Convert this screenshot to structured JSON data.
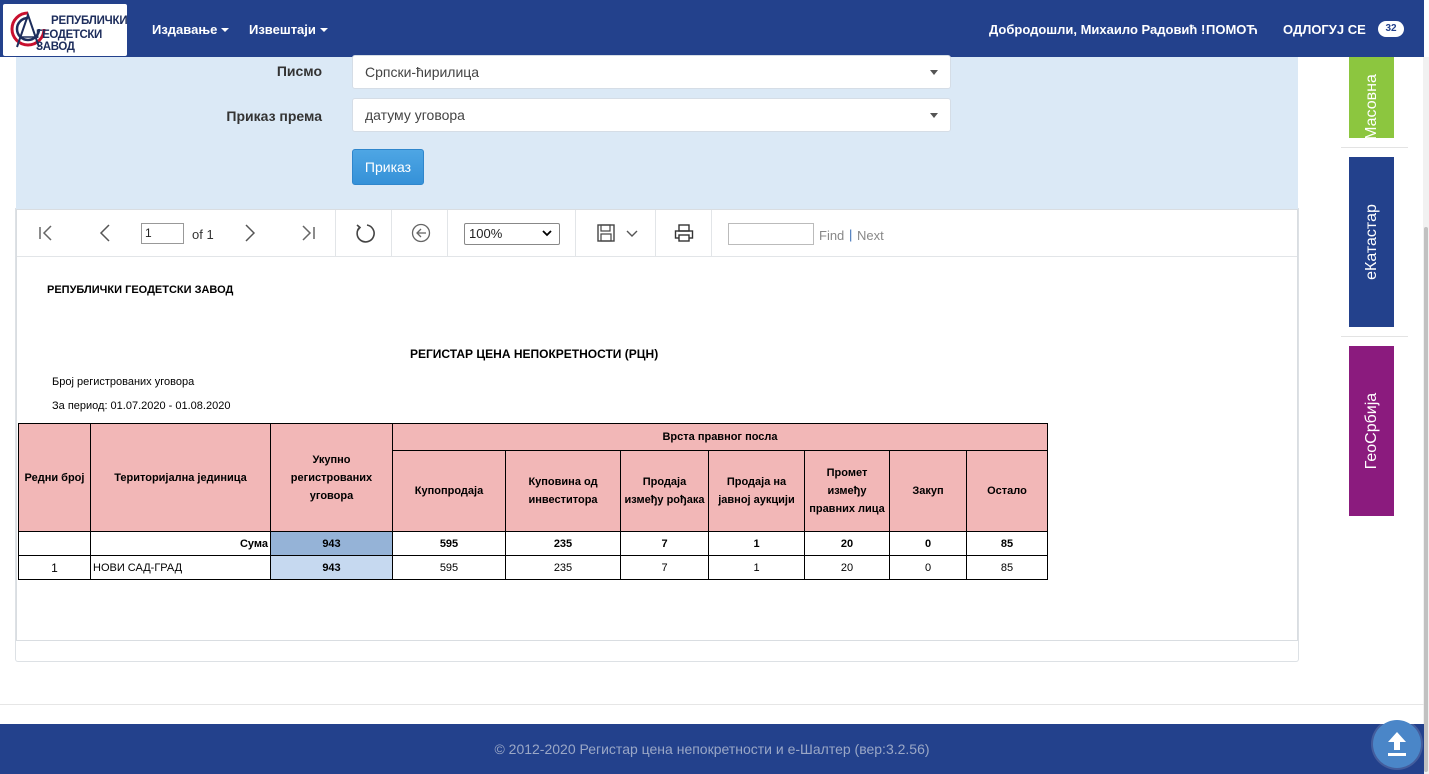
{
  "logo": {
    "line1": "РЕПУБЛИЧКИ",
    "line2": "ГЕОДЕТСКИ ЗАВОД"
  },
  "nav": {
    "menu": [
      {
        "label": "Издавање"
      },
      {
        "label": "Извештаји"
      }
    ],
    "welcome": "Добродошли, Михаило Радовић !",
    "help": "ПОМОЋ",
    "logout": "ОДЛОГУЈ СЕ",
    "badge": "32"
  },
  "form": {
    "script_label": "Писмо",
    "script_value": "Српски-ћирилица",
    "view_label": "Приказ према",
    "view_value": "датуму уговора",
    "show_button": "Приказ"
  },
  "toolbar": {
    "page_value": "1",
    "of_label": "of 1",
    "zoom": "100%",
    "find": "Find",
    "separator": "|",
    "next": "Next"
  },
  "report": {
    "org": "РЕПУБЛИЧКИ ГЕОДЕТСКИ ЗАВОД",
    "title": "РЕГИСТАР ЦЕНА НЕПОКРЕТНОСТИ (РЦН)",
    "subtitle": "Број регистрованих уговора",
    "period": "За период: 01.07.2020 - 01.08.2020",
    "headers": {
      "no": "Редни број",
      "unit": "Територијална јединица",
      "total": "Укупно регистрованих уговора",
      "group": "Врста правног посла",
      "types": [
        "Купопродаја",
        "Куповина од инвеститора",
        "Продаја између рођака",
        "Продаја на јавној аукцији",
        "Промет између правних лица",
        "Закуп",
        "Остало"
      ]
    },
    "sum_row": {
      "label": "Сума",
      "total": "943",
      "values": [
        "595",
        "235",
        "7",
        "1",
        "20",
        "0",
        "85"
      ]
    },
    "rows": [
      {
        "no": "1",
        "unit": "НОВИ САД-ГРАД",
        "total": "943",
        "values": [
          "595",
          "235",
          "7",
          "1",
          "20",
          "0",
          "85"
        ]
      }
    ]
  },
  "side": {
    "tiles": [
      {
        "label": "Масовна",
        "color": "#8cc63f"
      },
      {
        "label": "еКатастар",
        "color": "#23418c"
      },
      {
        "label": "ГеоСрбија",
        "color": "#8b1b7e"
      }
    ]
  },
  "footer": {
    "text": "© 2012-2020 Регистар цена непокретности и е-Шалтер (вер:3.2.56)"
  }
}
